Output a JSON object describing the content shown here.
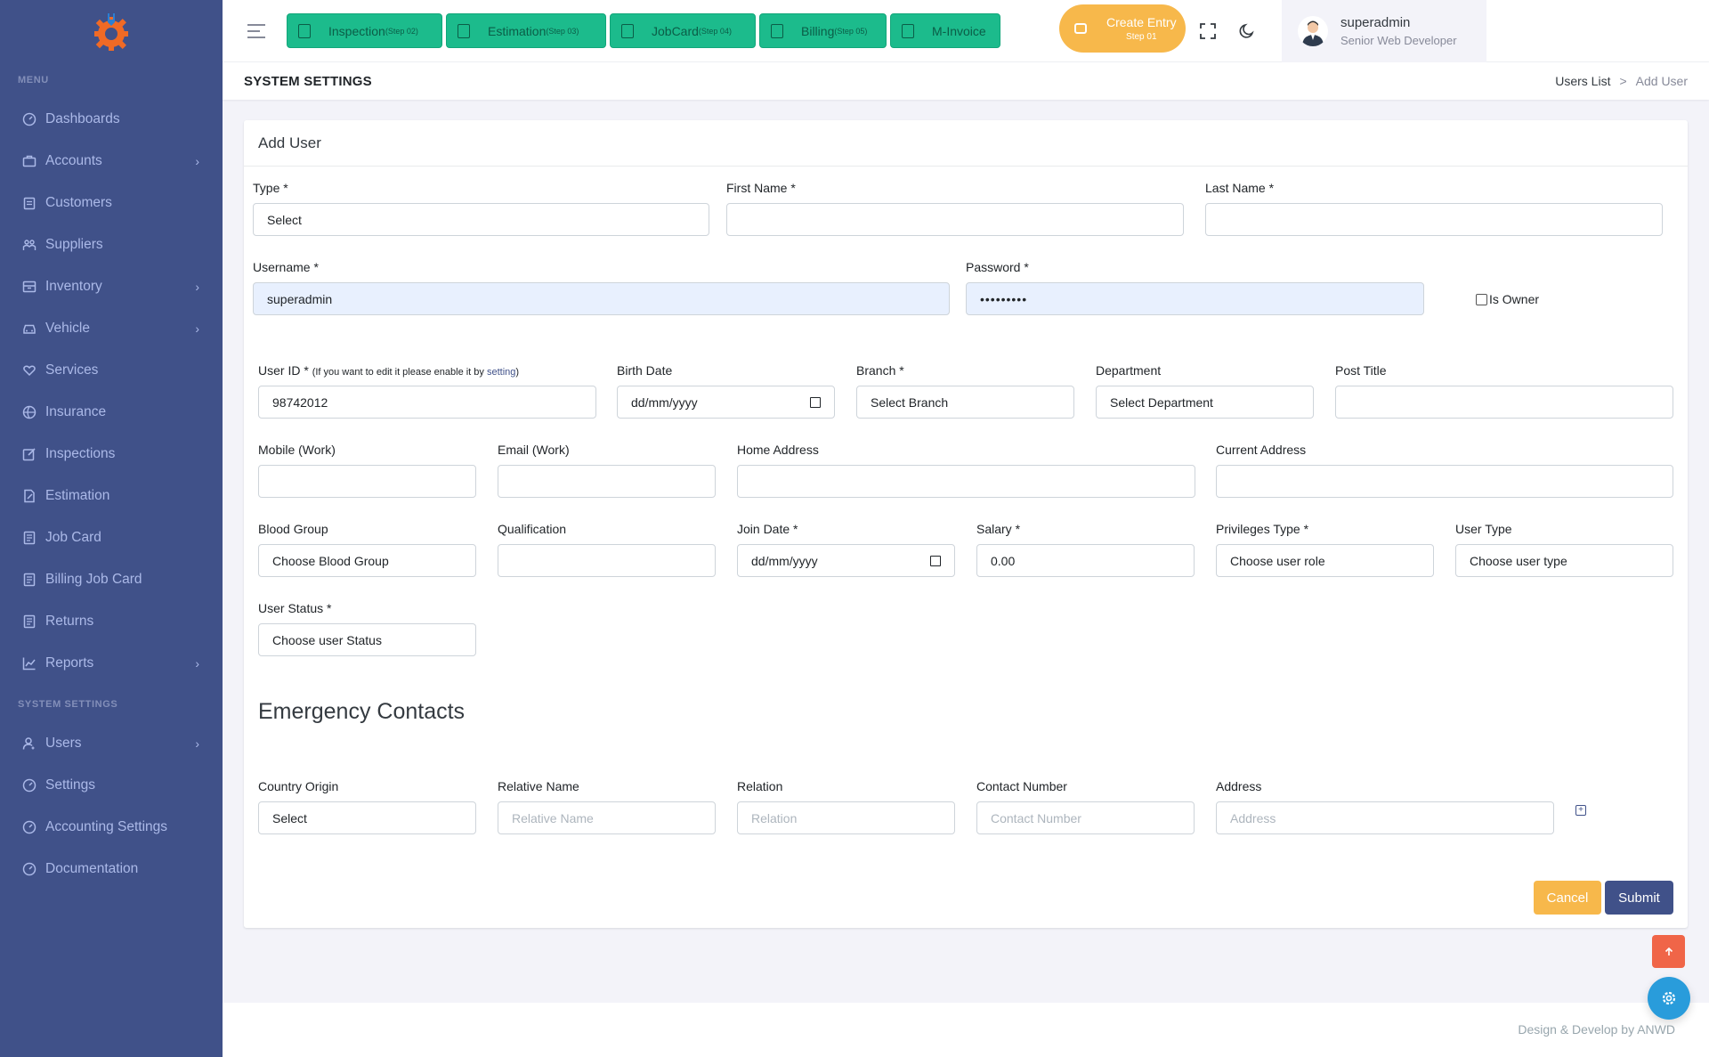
{
  "sidebar": {
    "menu_title": "MENU",
    "items": [
      {
        "label": "Dashboards",
        "icon": "dashboard-icon",
        "chevron": false
      },
      {
        "label": "Accounts",
        "icon": "briefcase-icon",
        "chevron": true
      },
      {
        "label": "Customers",
        "icon": "clipboard-icon",
        "chevron": false
      },
      {
        "label": "Suppliers",
        "icon": "users-group-icon",
        "chevron": false
      },
      {
        "label": "Inventory",
        "icon": "inventory-icon",
        "chevron": true
      },
      {
        "label": "Vehicle",
        "icon": "car-icon",
        "chevron": true
      },
      {
        "label": "Services",
        "icon": "heart-hand-icon",
        "chevron": false
      },
      {
        "label": "Insurance",
        "icon": "globe-icon",
        "chevron": false
      },
      {
        "label": "Inspections",
        "icon": "edit-box-icon",
        "chevron": false
      },
      {
        "label": "Estimation",
        "icon": "edit-doc-icon",
        "chevron": false
      },
      {
        "label": "Job Card",
        "icon": "document-icon",
        "chevron": false
      },
      {
        "label": "Billing Job Card",
        "icon": "document-icon",
        "chevron": false
      },
      {
        "label": "Returns",
        "icon": "document-icon",
        "chevron": false
      },
      {
        "label": "Reports",
        "icon": "chart-line-icon",
        "chevron": true
      }
    ],
    "system_title": "SYSTEM SETTINGS",
    "system_items": [
      {
        "label": "Users",
        "icon": "user-icon",
        "chevron": true
      },
      {
        "label": "Settings",
        "icon": "dashboard-icon",
        "chevron": false
      },
      {
        "label": "Accounting Settings",
        "icon": "dashboard-icon",
        "chevron": false
      },
      {
        "label": "Documentation",
        "icon": "dashboard-icon",
        "chevron": false
      }
    ]
  },
  "topbar": {
    "steps": [
      {
        "label": "Inspection",
        "step": "(Step 02)"
      },
      {
        "label": "Estimation",
        "step": "(Step 03)"
      },
      {
        "label": "JobCard",
        "step": "(Step 04)"
      },
      {
        "label": "Billing",
        "step": "(Step 05)"
      },
      {
        "label": "M-Invoice",
        "step": ""
      }
    ],
    "create_entry": {
      "label": "Create Entry",
      "step": "Step 01"
    },
    "user": {
      "name": "superadmin",
      "role": "Senior Web Developer"
    }
  },
  "page": {
    "title": "SYSTEM SETTINGS",
    "breadcrumb": {
      "parent": "Users List",
      "sep": ">",
      "current": "Add User"
    }
  },
  "form": {
    "card_title": "Add User",
    "type": {
      "label": "Type *",
      "value": "Select"
    },
    "first_name": {
      "label": "First Name *",
      "value": ""
    },
    "last_name": {
      "label": "Last Name *",
      "value": ""
    },
    "username": {
      "label": "Username *",
      "value": "superadmin"
    },
    "password": {
      "label": "Password *",
      "value": "•••••••••"
    },
    "is_owner": {
      "label": "Is Owner"
    },
    "user_id": {
      "label": "User ID *",
      "note_prefix": "(If you want to edit it please enable it by ",
      "note_link": "setting",
      "note_suffix": ")",
      "value": "98742012"
    },
    "birth_date": {
      "label": "Birth Date",
      "value": "dd/mm/yyyy"
    },
    "branch": {
      "label": "Branch *",
      "value": "Select Branch"
    },
    "department": {
      "label": "Department",
      "value": "Select Department"
    },
    "post_title": {
      "label": "Post Title",
      "value": ""
    },
    "mobile": {
      "label": "Mobile (Work)",
      "value": ""
    },
    "email": {
      "label": "Email (Work)",
      "value": ""
    },
    "home_address": {
      "label": "Home Address",
      "value": ""
    },
    "current_address": {
      "label": "Current Address",
      "value": ""
    },
    "blood_group": {
      "label": "Blood Group",
      "value": "Choose Blood Group"
    },
    "qualification": {
      "label": "Qualification",
      "value": ""
    },
    "join_date": {
      "label": "Join Date *",
      "value": "dd/mm/yyyy"
    },
    "salary": {
      "label": "Salary *",
      "value": "0.00"
    },
    "privileges": {
      "label": "Privileges Type *",
      "value": "Choose user role"
    },
    "user_type": {
      "label": "User Type",
      "value": "Choose user type"
    },
    "user_status": {
      "label": "User Status *",
      "value": "Choose user Status"
    },
    "emergency_title": "Emergency Contacts",
    "country_origin": {
      "label": "Country Origin",
      "value": "Select"
    },
    "relative_name": {
      "label": "Relative Name",
      "placeholder": "Relative Name"
    },
    "relation": {
      "label": "Relation",
      "placeholder": "Relation"
    },
    "contact_number": {
      "label": "Contact Number",
      "placeholder": "Contact Number"
    },
    "address": {
      "label": "Address",
      "placeholder": "Address"
    },
    "cancel_label": "Cancel",
    "submit_label": "Submit"
  },
  "footer": {
    "text": "Design & Develop by ANWD"
  },
  "colors": {
    "sidebar": "#405189",
    "step_button": "#1cbb8c",
    "create_entry": "#f7b84b",
    "cancel": "#f7b84b",
    "submit": "#405189",
    "back_top": "#f06548",
    "fab": "#299cdb"
  }
}
